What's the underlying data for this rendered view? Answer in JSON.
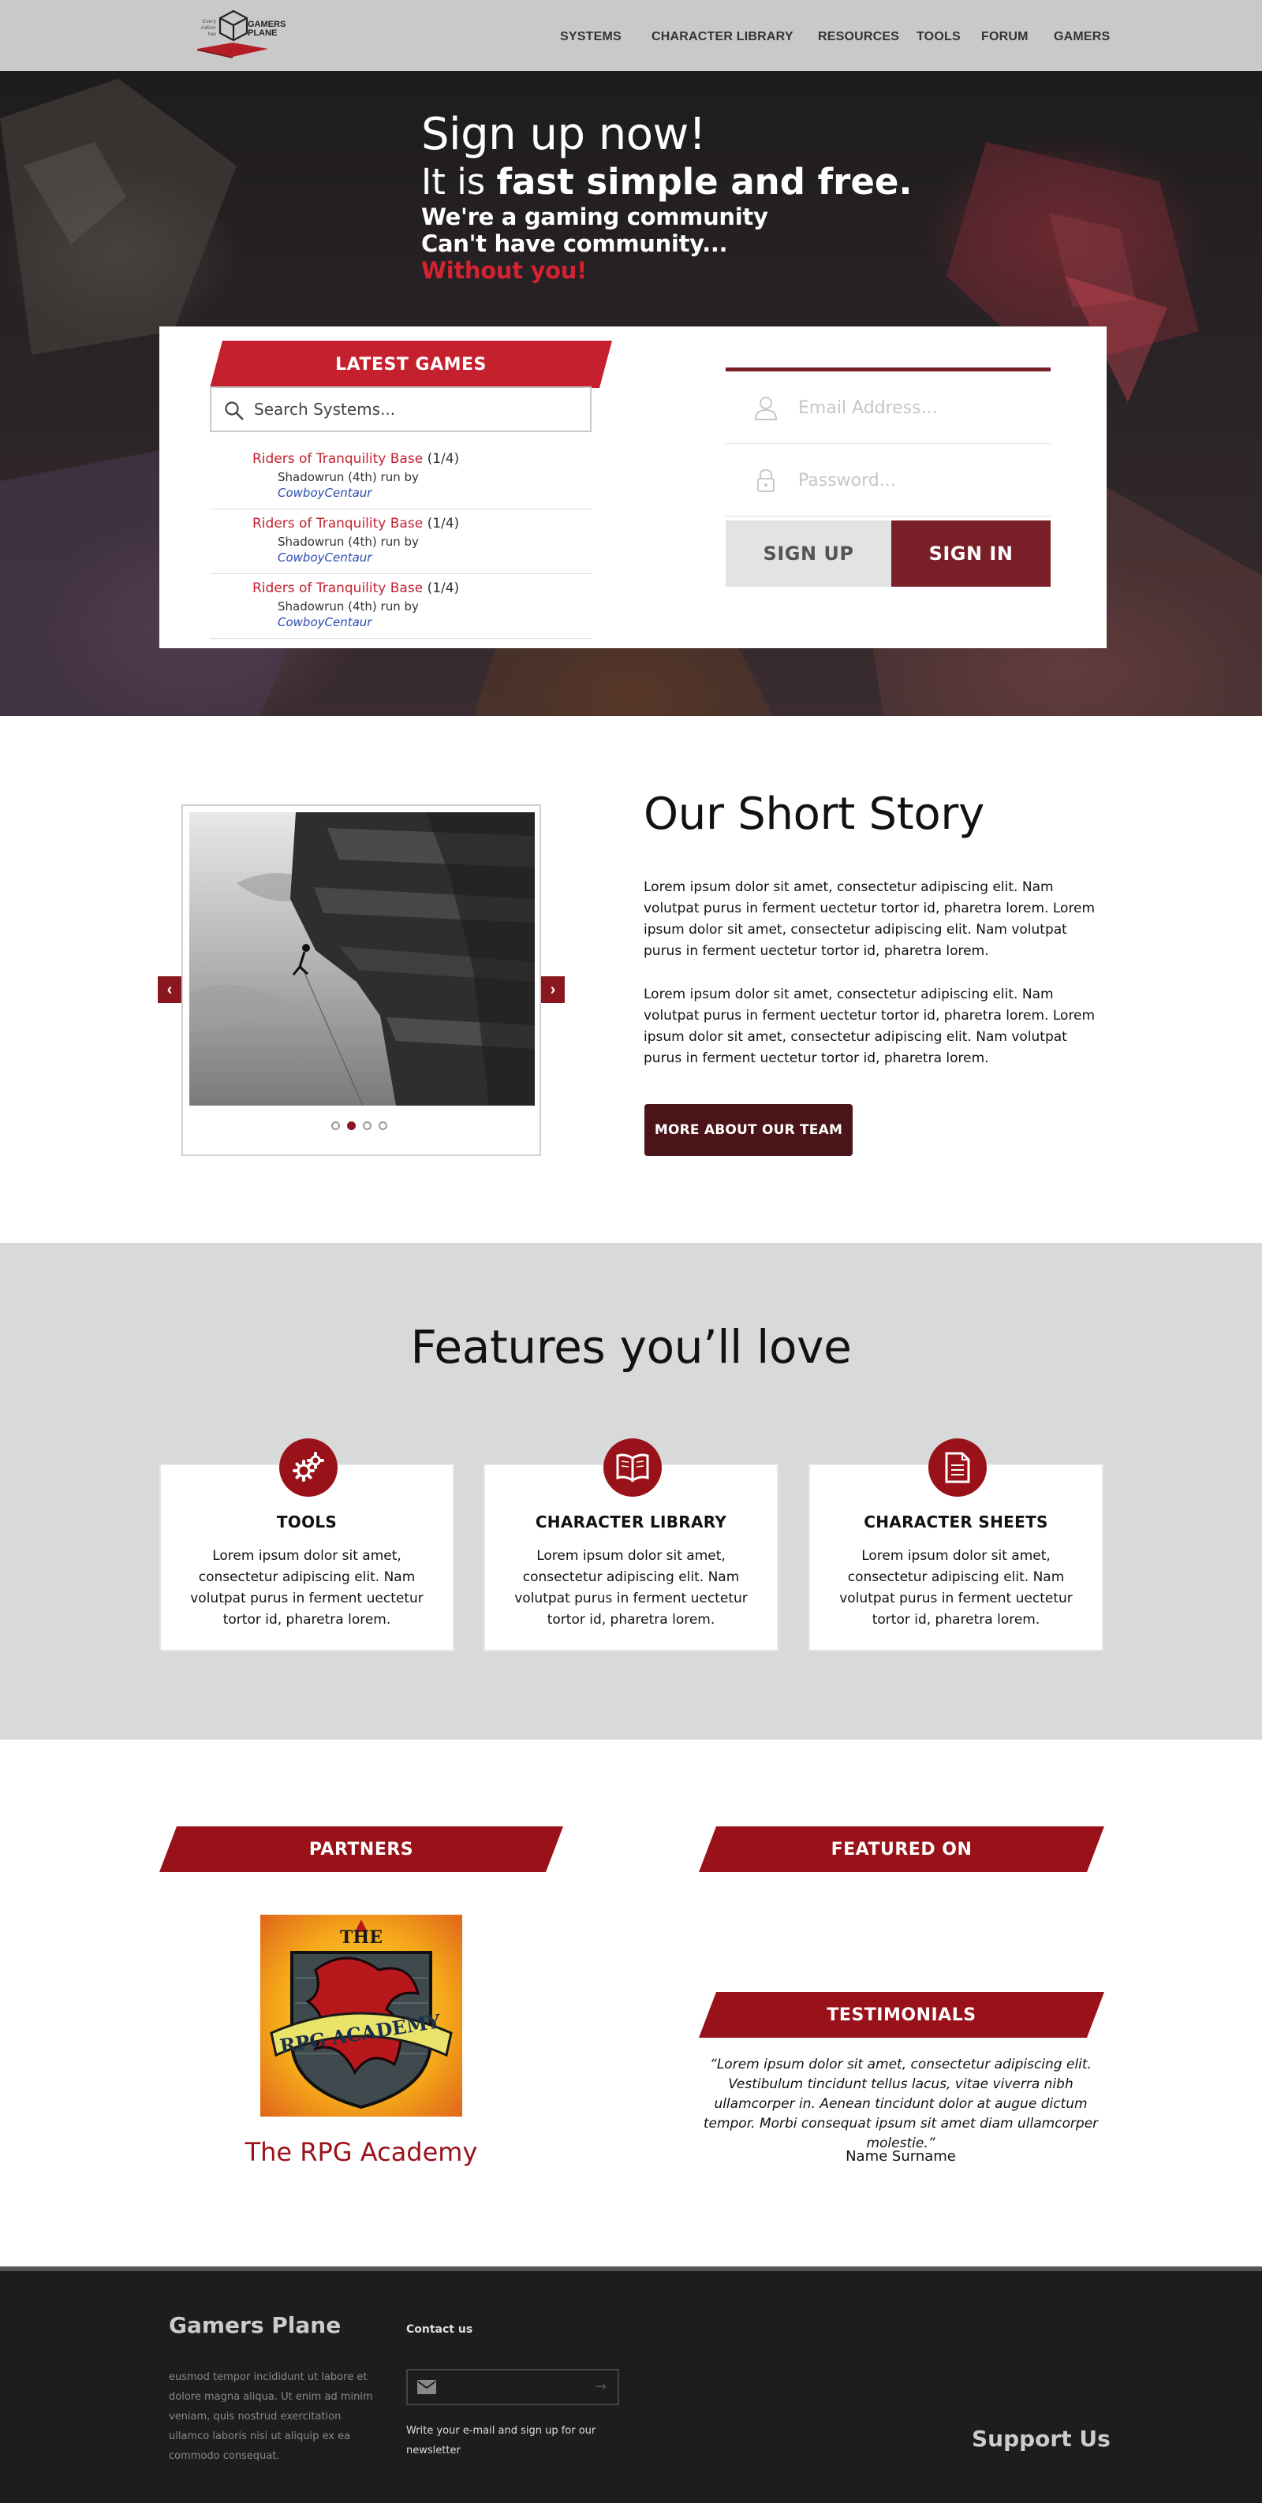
{
  "header": {
    "logo_small_text": [
      "Every",
      "nation",
      "has"
    ],
    "logo_text": [
      "GAMERS",
      "PLANE"
    ],
    "nav": [
      {
        "label": "SYSTEMS"
      },
      {
        "label": "CHARACTER LIBRARY"
      },
      {
        "label": "RESOURCES"
      },
      {
        "label": "TOOLS"
      },
      {
        "label": "FORUM"
      },
      {
        "label": "GAMERS"
      }
    ]
  },
  "hero": {
    "title": "Sign up now!",
    "subtitle_prefix": "It is ",
    "subtitle_bold": "fast simple and free.",
    "line1": "We're a gaming community",
    "line2": "Can't have community...",
    "line3": "Without you!"
  },
  "latest_games": {
    "title": "LATEST GAMES",
    "search_placeholder": "Search Systems...",
    "games": [
      {
        "title": "Riders of Tranquility Base",
        "count": "(1/4)",
        "system": "Shadowrun (4th) run by",
        "user": "CowboyCentaur"
      },
      {
        "title": "Riders of Tranquility Base",
        "count": "(1/4)",
        "system": "Shadowrun (4th) run by",
        "user": "CowboyCentaur"
      },
      {
        "title": "Riders of Tranquility Base",
        "count": "(1/4)",
        "system": "Shadowrun (4th) run by",
        "user": "CowboyCentaur"
      }
    ]
  },
  "login": {
    "email_placeholder": "Email Address...",
    "password_placeholder": "Password...",
    "signup_label": "SIGN UP",
    "signin_label": "SIGN IN"
  },
  "story": {
    "title": "Our Short Story",
    "paragraphs": [
      "Lorem ipsum dolor sit amet, consectetur adipiscing elit. Nam volutpat purus in ferment uectetur tortor id, pharetra lorem. Lorem ipsum dolor sit amet, consectetur adipiscing elit. Nam volutpat purus in ferment uectetur tortor id, pharetra lorem.",
      "Lorem ipsum dolor sit amet, consectetur adipiscing elit. Nam volutpat purus in ferment uectetur tortor id, pharetra lorem. Lorem ipsum dolor sit amet, consectetur adipiscing elit. Nam volutpat purus in ferment uectetur tortor id, pharetra lorem."
    ],
    "button_label": "MORE ABOUT OUR TEAM",
    "slider_prev": "‹",
    "slider_next": "›",
    "slide_count": 4,
    "active_slide": 2
  },
  "features": {
    "title": "Features you’ll love",
    "cards": [
      {
        "icon": "gears-icon",
        "title": "TOOLS",
        "text": "Lorem ipsum dolor sit amet, consectetur adipiscing elit. Nam volutpat purus in ferment uectetur tortor id, pharetra lorem."
      },
      {
        "icon": "book-icon",
        "title": "CHARACTER LIBRARY",
        "text": "Lorem ipsum dolor sit amet, consectetur adipiscing elit. Nam volutpat purus in ferment uectetur tortor id, pharetra lorem."
      },
      {
        "icon": "document-icon",
        "title": "CHARACTER SHEETS",
        "text": "Lorem ipsum dolor sit amet, consectetur adipiscing elit. Nam volutpat purus in ferment uectetur tortor id, pharetra lorem."
      }
    ]
  },
  "partners": {
    "title": "PARTNERS",
    "partner_name": "The RPG Academy",
    "logo_text": [
      "THE",
      "RPG ACADEMY"
    ],
    "featured_title": "FEATURED ON",
    "testimonials_title": "TESTIMONIALS",
    "quote": "“Lorem ipsum dolor sit amet, consectetur adipiscing elit. Vestibulum tincidunt tellus lacus, vitae viverra nibh ullamcorper in. Aenean tincidunt dolor at augue dictum tempor. Morbi consequat ipsum sit amet diam ullamcorper molestie.”",
    "quote_author": "Name Surname"
  },
  "footer": {
    "brand": "Gamers Plane",
    "text": "eusmod tempor incididunt ut labore et dolore magna aliqua. Ut enim ad minim veniam, quis nostrud exercitation ullamco laboris nisi ut aliquip ex ea commodo consequat.",
    "contact_title": "Contact us",
    "email_arrow": "→",
    "newsletter_note": "Write your e-mail and sign up for our newsletter",
    "support": "Support Us"
  },
  "colors": {
    "brand_red": "#c5202e",
    "dark_red": "#7a1f28",
    "icon_red": "#9a1219",
    "features_bg": "#d7dad8",
    "footer_bg": "#1d1d1d"
  }
}
